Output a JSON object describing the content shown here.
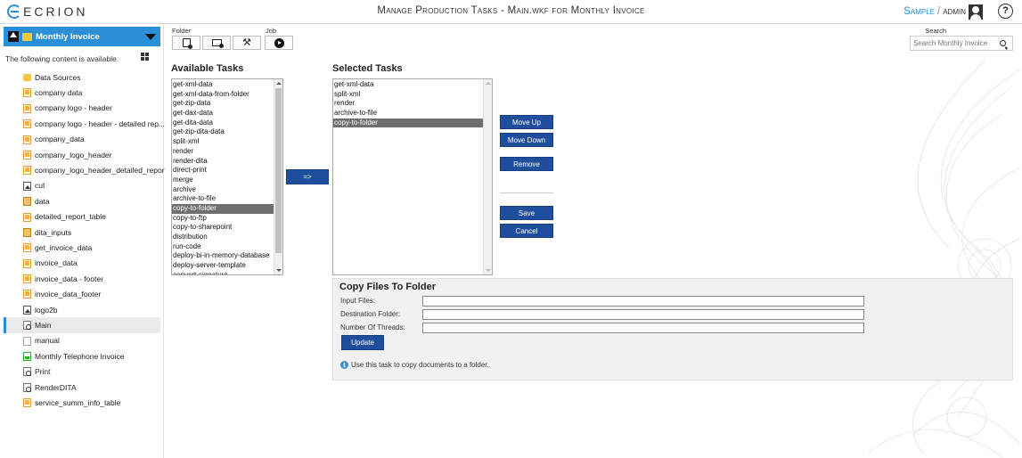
{
  "app": {
    "logo_text": "ECRION",
    "page_heading": "Manage Production Tasks - Main.wkf for Monthly Invoice",
    "user_context": "Sample",
    "user_name": "admin",
    "help_label": "?"
  },
  "sidebar": {
    "project_title": "Monthly Invoice",
    "availability_message": "The following content is available.",
    "items": [
      {
        "label": "Data Sources",
        "icon": "folder-icon",
        "active": false
      },
      {
        "label": "company data",
        "icon": "data-file-icon",
        "active": false
      },
      {
        "label": "company logo - header",
        "icon": "data-file-icon",
        "active": false
      },
      {
        "label": "company logo - header - detailed rep...",
        "icon": "data-file-icon",
        "active": false
      },
      {
        "label": "company_data",
        "icon": "data-file-icon",
        "active": false
      },
      {
        "label": "company_logo_header",
        "icon": "data-file-icon",
        "active": false
      },
      {
        "label": "company_logo_header_detailed_report",
        "icon": "data-file-icon",
        "active": false
      },
      {
        "label": "cut",
        "icon": "image-icon",
        "active": false
      },
      {
        "label": "data",
        "icon": "zip-file-icon",
        "active": false
      },
      {
        "label": "detailed_report_table",
        "icon": "data-file-icon",
        "active": false
      },
      {
        "label": "dita_inputs",
        "icon": "zip-file-icon",
        "active": false
      },
      {
        "label": "get_invoice_data",
        "icon": "data-file-icon",
        "active": false
      },
      {
        "label": "invoice_data",
        "icon": "data-file-icon",
        "active": false
      },
      {
        "label": "invoice_data - footer",
        "icon": "data-file-icon",
        "active": false
      },
      {
        "label": "invoice_data_footer",
        "icon": "data-file-icon",
        "active": false
      },
      {
        "label": "logo2b",
        "icon": "image-icon",
        "active": false
      },
      {
        "label": "Main",
        "icon": "workflow-file-icon",
        "active": true
      },
      {
        "label": "manual",
        "icon": "plain-file-icon",
        "active": false
      },
      {
        "label": "Monthly Telephone Invoice",
        "icon": "document-file-icon",
        "active": false
      },
      {
        "label": "Print",
        "icon": "workflow-file-icon",
        "active": false
      },
      {
        "label": "RenderDITA",
        "icon": "workflow-file-icon",
        "active": false
      },
      {
        "label": "service_summ_info_table",
        "icon": "data-file-icon",
        "active": false
      }
    ]
  },
  "toolbar": {
    "folder_group_label": "Folder",
    "job_group_label": "Job",
    "search_label": "Search",
    "search_placeholder": "Search Monthly Invoice"
  },
  "available_tasks": {
    "title": "Available Tasks",
    "items": [
      "get-xml-data",
      "get-xml-data-from-folder",
      "get-zip-data",
      "get-dax-data",
      "get-dita-data",
      "get-zip-dita-data",
      "split-xml",
      "render",
      "render-dita",
      "direct-print",
      "merge",
      "archive",
      "archive-to-file",
      "copy-to-folder",
      "copy-to-ftp",
      "copy-to-sharepoint",
      "distribution",
      "run-code",
      "deploy-bi-in-memory-database",
      "deploy-server-template",
      "convert-signature"
    ],
    "selected_item": "copy-to-folder",
    "scroll_position": 0.05
  },
  "add_button_label": "=>",
  "selected_tasks": {
    "title": "Selected Tasks",
    "items": [
      "get-xml-data",
      "split-xml",
      "render",
      "archive-to-file",
      "copy-to-folder"
    ],
    "selected_item": "copy-to-folder"
  },
  "actions": {
    "move_up": "Move Up",
    "move_down": "Move Down",
    "remove": "Remove",
    "save": "Save",
    "cancel": "Cancel"
  },
  "task_details": {
    "title": "Copy Files To Folder",
    "fields": [
      {
        "label": "Input Files:",
        "value": ""
      },
      {
        "label": "Destination Folder:",
        "value": ""
      },
      {
        "label": "Number Of Threads:",
        "value": ""
      }
    ],
    "update_label": "Update",
    "info_text": "Use this task to copy documents to a folder."
  },
  "colors": {
    "accent_blue": "#2a8fd6",
    "button_navy": "#1f4e9c",
    "selection_gray": "#6e6e6e"
  }
}
